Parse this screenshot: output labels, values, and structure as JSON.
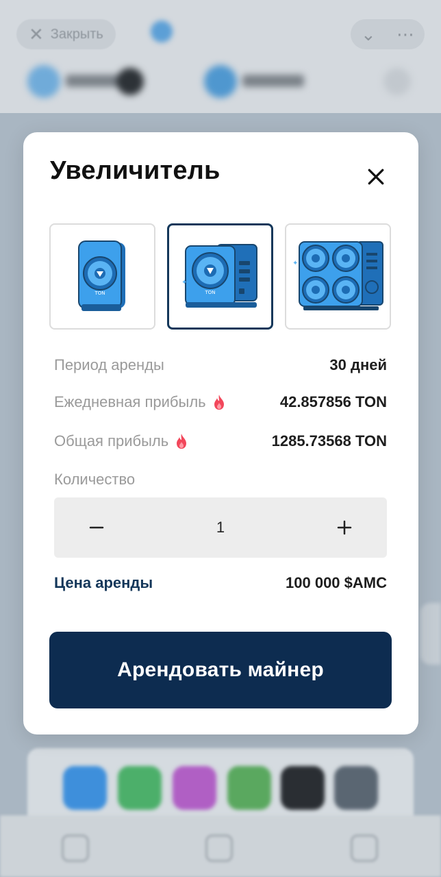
{
  "background": {
    "close_label": "Закрыть"
  },
  "modal": {
    "title": "Увеличитель",
    "miners": [
      {
        "name": "small-miner",
        "selected": false
      },
      {
        "name": "medium-miner",
        "selected": true
      },
      {
        "name": "large-miner",
        "selected": false
      }
    ],
    "details": {
      "rent_period_label": "Период аренды",
      "rent_period_value": "30 дней",
      "daily_profit_label": "Ежедневная прибыль",
      "daily_profit_value": "42.857856 TON",
      "total_profit_label": "Общая прибыль",
      "total_profit_value": "1285.73568 TON"
    },
    "quantity": {
      "label": "Количество",
      "value": "1"
    },
    "price": {
      "label": "Цена аренды",
      "value": "100 000 $AMC"
    },
    "rent_button_label": "Арендовать майнер"
  },
  "colors": {
    "primary": "#0d2c50",
    "accent_text": "#14375a",
    "miner_blue": "#2f8fdc",
    "flame": "#f2475b"
  }
}
